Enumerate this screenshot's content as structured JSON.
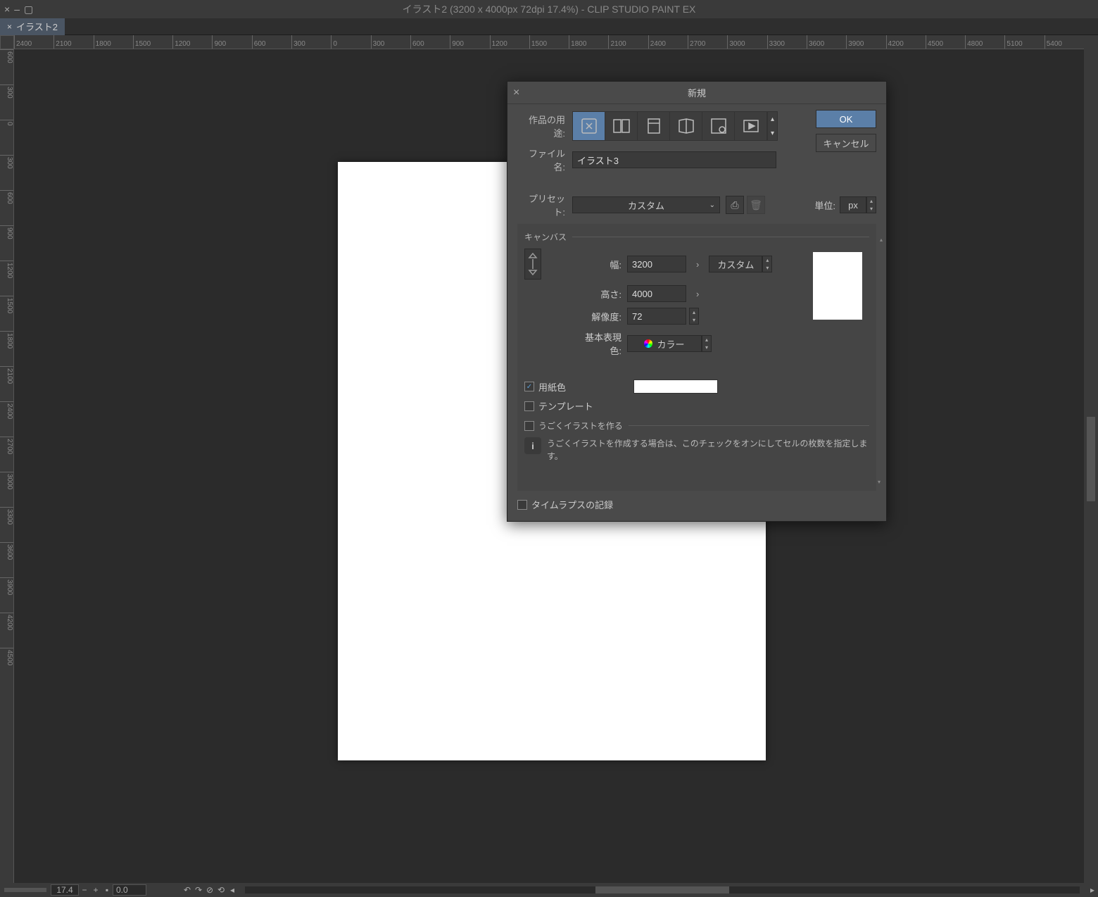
{
  "titlebar": {
    "title": "イラスト2 (3200 x 4000px 72dpi 17.4%)  - CLIP STUDIO PAINT EX"
  },
  "tab": {
    "label": "イラスト2"
  },
  "ruler_h": [
    "2400",
    "2100",
    "1800",
    "1500",
    "1200",
    "900",
    "600",
    "300",
    "0",
    "300",
    "600",
    "900",
    "1200",
    "1500",
    "1800",
    "2100",
    "2400",
    "2700",
    "3000",
    "3300",
    "3600",
    "3900",
    "4200",
    "4500",
    "4800",
    "5100",
    "5400"
  ],
  "ruler_v": [
    "600",
    "300",
    "0",
    "300",
    "600",
    "900",
    "1200",
    "1500",
    "1800",
    "2100",
    "2400",
    "2700",
    "3000",
    "3300",
    "3600",
    "3900",
    "4200",
    "4500"
  ],
  "status": {
    "zoom": "17.4",
    "rotation": "0.0"
  },
  "dialog": {
    "title": "新規",
    "ok": "OK",
    "cancel": "キャンセル",
    "usage_label": "作品の用途:",
    "filename_label": "ファイル名:",
    "filename": "イラスト3",
    "preset_label": "プリセット:",
    "preset": "カスタム",
    "unit_label": "単位:",
    "unit": "px",
    "canvas_section": "キャンバス",
    "width_label": "幅:",
    "width": "3200",
    "size_preset": "カスタム",
    "height_label": "高さ:",
    "height": "4000",
    "resolution_label": "解像度:",
    "resolution": "72",
    "basic_color_label": "基本表現色:",
    "basic_color": "カラー",
    "paper_color_label": "用紙色",
    "template_label": "テンプレート",
    "moving_illust_section": "うごくイラストを作る",
    "help_text": "うごくイラストを作成する場合は、このチェックをオンにしてセルの枚数を指定します。",
    "timelapse_label": "タイムラプスの記録"
  }
}
